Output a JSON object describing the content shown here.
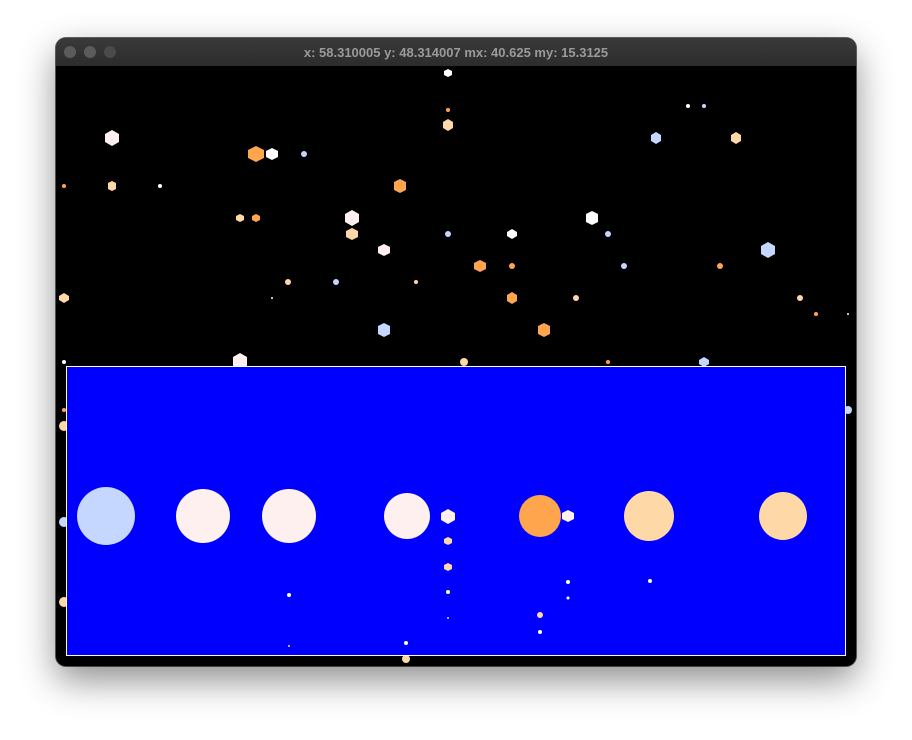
{
  "window": {
    "title": "x: 58.310005 y: 48.314007 mx: 40.625 my: 15.3125",
    "controls": [
      "close-button",
      "minimize-button",
      "zoom-button"
    ]
  },
  "scene": {
    "background_color": "#000000",
    "panel_color": "#0000ff",
    "panel_border_color": "#ffffff",
    "star_colors": {
      "white": "#ffffff",
      "warm": "#fff0f0",
      "blue": "#c5d6ff",
      "peach": "#ffd8a8",
      "orange": "#ffa54d"
    }
  }
}
